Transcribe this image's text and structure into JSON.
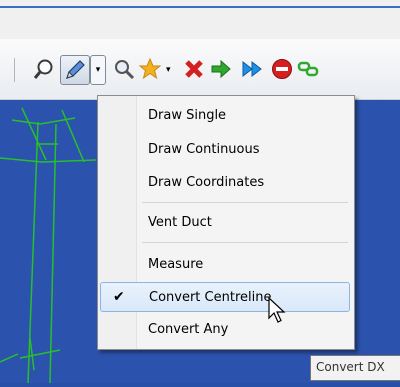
{
  "toolbar": {
    "tools": [
      {
        "name": "zoom-icon"
      },
      {
        "name": "pencil-icon"
      },
      {
        "name": "magnify-icon"
      },
      {
        "name": "star-icon"
      },
      {
        "name": "delete-icon"
      },
      {
        "name": "arrow-right-icon"
      },
      {
        "name": "double-arrow-icon"
      },
      {
        "name": "stop-icon"
      },
      {
        "name": "link-icon"
      }
    ],
    "colors": {
      "delete": "#d42020",
      "arrow": "#2fa82f",
      "double_arrow": "#1e8fe6",
      "stop": "#d42020",
      "star": "#f3b21a"
    }
  },
  "menu": {
    "items": [
      {
        "label": "Draw Single",
        "checked": false
      },
      {
        "label": "Draw Continuous",
        "checked": false
      },
      {
        "label": "Draw Coordinates",
        "checked": false
      },
      {
        "label": "Vent Duct",
        "checked": false
      },
      {
        "label": "Measure",
        "checked": false
      },
      {
        "label": "Convert Centreline",
        "checked": true,
        "highlighted": true
      },
      {
        "label": "Convert Any",
        "checked": false
      }
    ],
    "check_mark": "✔"
  },
  "tooltip": {
    "text": "Convert DX"
  },
  "colors": {
    "canvas": "#2b52ac",
    "lines": "#27c02b"
  }
}
